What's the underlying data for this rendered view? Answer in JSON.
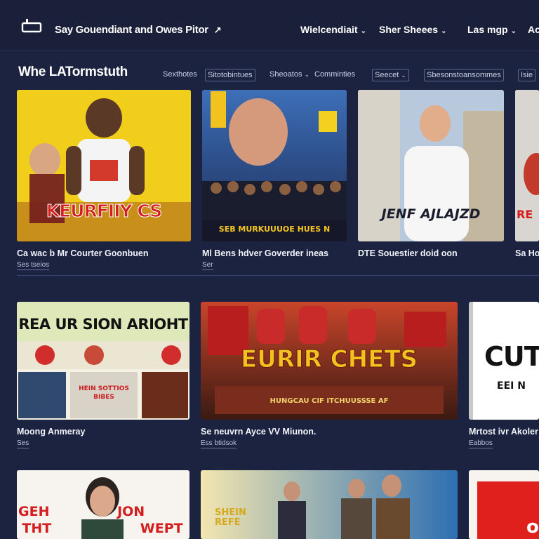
{
  "header": {
    "app_title": "Say Gouendiant and Owes Pitor",
    "nav": [
      {
        "label": "Wielcendiait"
      },
      {
        "label": "Sher Sheees"
      },
      {
        "label": "Las mgp"
      },
      {
        "label": "Ac"
      }
    ]
  },
  "section": {
    "title": "Whe LATormstuth",
    "filters": [
      {
        "label": "Sexthotes"
      },
      {
        "label": "Sitotobintues"
      },
      {
        "label": "Sheoatos"
      },
      {
        "label": "Comminties"
      },
      {
        "label": "Seecet"
      },
      {
        "label": "Sbesonstoansommes"
      },
      {
        "label": "Isie"
      }
    ]
  },
  "row1": [
    {
      "title": "Ca wac b Mr Courter Goonbuen",
      "sub": "Ses tseios",
      "poster_text": "KEURFIIY CS"
    },
    {
      "title": "Ml Bens hdver Goverder ineas",
      "sub": "Ser",
      "poster_text": "SEB MURKUUUOE HUES N"
    },
    {
      "title": "DTE Souestier doid oon",
      "sub": "",
      "poster_text": "JENF AJLAJZD"
    },
    {
      "title": "Sa Hot",
      "sub": "",
      "poster_text": "RE"
    }
  ],
  "row2": [
    {
      "title": "Moong Anmeray",
      "sub": "Ses",
      "poster_text": "REA UR SION ARIOHT",
      "poster_sub": "HEIN SOTTIOS BIBES"
    },
    {
      "title": "Se neuvrn Ayce VV Miunon.",
      "sub": "Ess btidsok",
      "poster_text": "EURIR CHETS",
      "poster_sub": "HUNGCAU CIF ITCHUUSSSE AF"
    },
    {
      "title": "Mrtost ivr Akoler",
      "sub": "Eabbos",
      "poster_text": "CUTR",
      "poster_sub": "EEI N"
    }
  ],
  "row3": [
    {
      "poster_text": "GEH JON VIILAV",
      "poster_sub": "THT WEPT"
    },
    {
      "poster_text": "SHEIN REFE"
    },
    {
      "poster_text": "o"
    }
  ]
}
